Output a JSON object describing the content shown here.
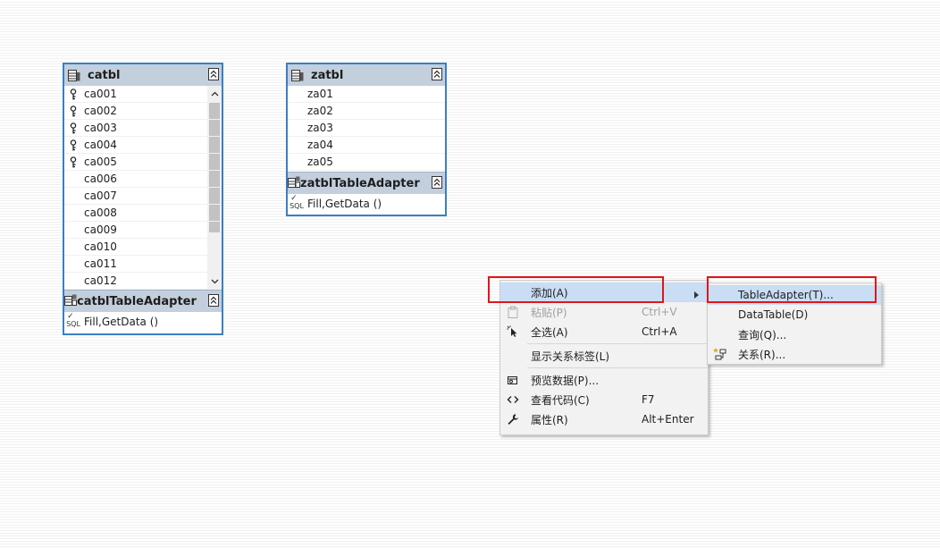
{
  "catbl": {
    "title": "catbl",
    "columns": [
      {
        "name": "ca001",
        "key": true
      },
      {
        "name": "ca002",
        "key": true
      },
      {
        "name": "ca003",
        "key": true
      },
      {
        "name": "ca004",
        "key": true
      },
      {
        "name": "ca005",
        "key": true
      },
      {
        "name": "ca006",
        "key": false
      },
      {
        "name": "ca007",
        "key": false
      },
      {
        "name": "ca008",
        "key": false
      },
      {
        "name": "ca009",
        "key": false
      },
      {
        "name": "ca010",
        "key": false
      },
      {
        "name": "ca011",
        "key": false
      },
      {
        "name": "ca012",
        "key": false
      }
    ],
    "adapter_title": "catblTableAdapter",
    "method": "Fill,GetData ()",
    "sql_label": "SQL"
  },
  "zatbl": {
    "title": "zatbl",
    "columns": [
      {
        "name": "za01",
        "key": false
      },
      {
        "name": "za02",
        "key": false
      },
      {
        "name": "za03",
        "key": false
      },
      {
        "name": "za04",
        "key": false
      },
      {
        "name": "za05",
        "key": false
      }
    ],
    "adapter_title": "zatblTableAdapter",
    "method": "Fill,GetData ()",
    "sql_label": "SQL"
  },
  "context_menu": {
    "items": [
      {
        "label": "添加(A)",
        "shortcut": "",
        "icon": "none",
        "disabled": false,
        "highlight": true,
        "submenu": true
      },
      {
        "label": "粘贴(P)",
        "shortcut": "Ctrl+V",
        "icon": "paste-icon",
        "disabled": true,
        "highlight": false,
        "submenu": false
      },
      {
        "label": "全选(A)",
        "shortcut": "Ctrl+A",
        "icon": "select-all-icon",
        "disabled": false,
        "highlight": false,
        "submenu": false
      },
      {
        "label": "显示关系标签(L)",
        "shortcut": "",
        "icon": "none",
        "disabled": false,
        "highlight": false,
        "submenu": false
      },
      {
        "label": "预览数据(P)...",
        "shortcut": "",
        "icon": "preview-data-icon",
        "disabled": false,
        "highlight": false,
        "submenu": false
      },
      {
        "label": "查看代码(C)",
        "shortcut": "F7",
        "icon": "view-code-icon",
        "disabled": false,
        "highlight": false,
        "submenu": false
      },
      {
        "label": "属性(R)",
        "shortcut": "Alt+Enter",
        "icon": "wrench-icon",
        "disabled": false,
        "highlight": false,
        "submenu": false
      }
    ]
  },
  "submenu": {
    "items": [
      {
        "label": "TableAdapter(T)...",
        "icon": "none",
        "highlight": true
      },
      {
        "label": "DataTable(D)",
        "icon": "none",
        "highlight": false
      },
      {
        "label": "查询(Q)...",
        "icon": "none",
        "highlight": false
      },
      {
        "label": "关系(R)...",
        "icon": "relation-icon",
        "highlight": false
      }
    ]
  },
  "colors": {
    "table_border": "#3b7fc4",
    "header_bg": "#c3cfdc",
    "menu_highlight": "#c9ddf4",
    "annotation_red": "#e0161c"
  }
}
